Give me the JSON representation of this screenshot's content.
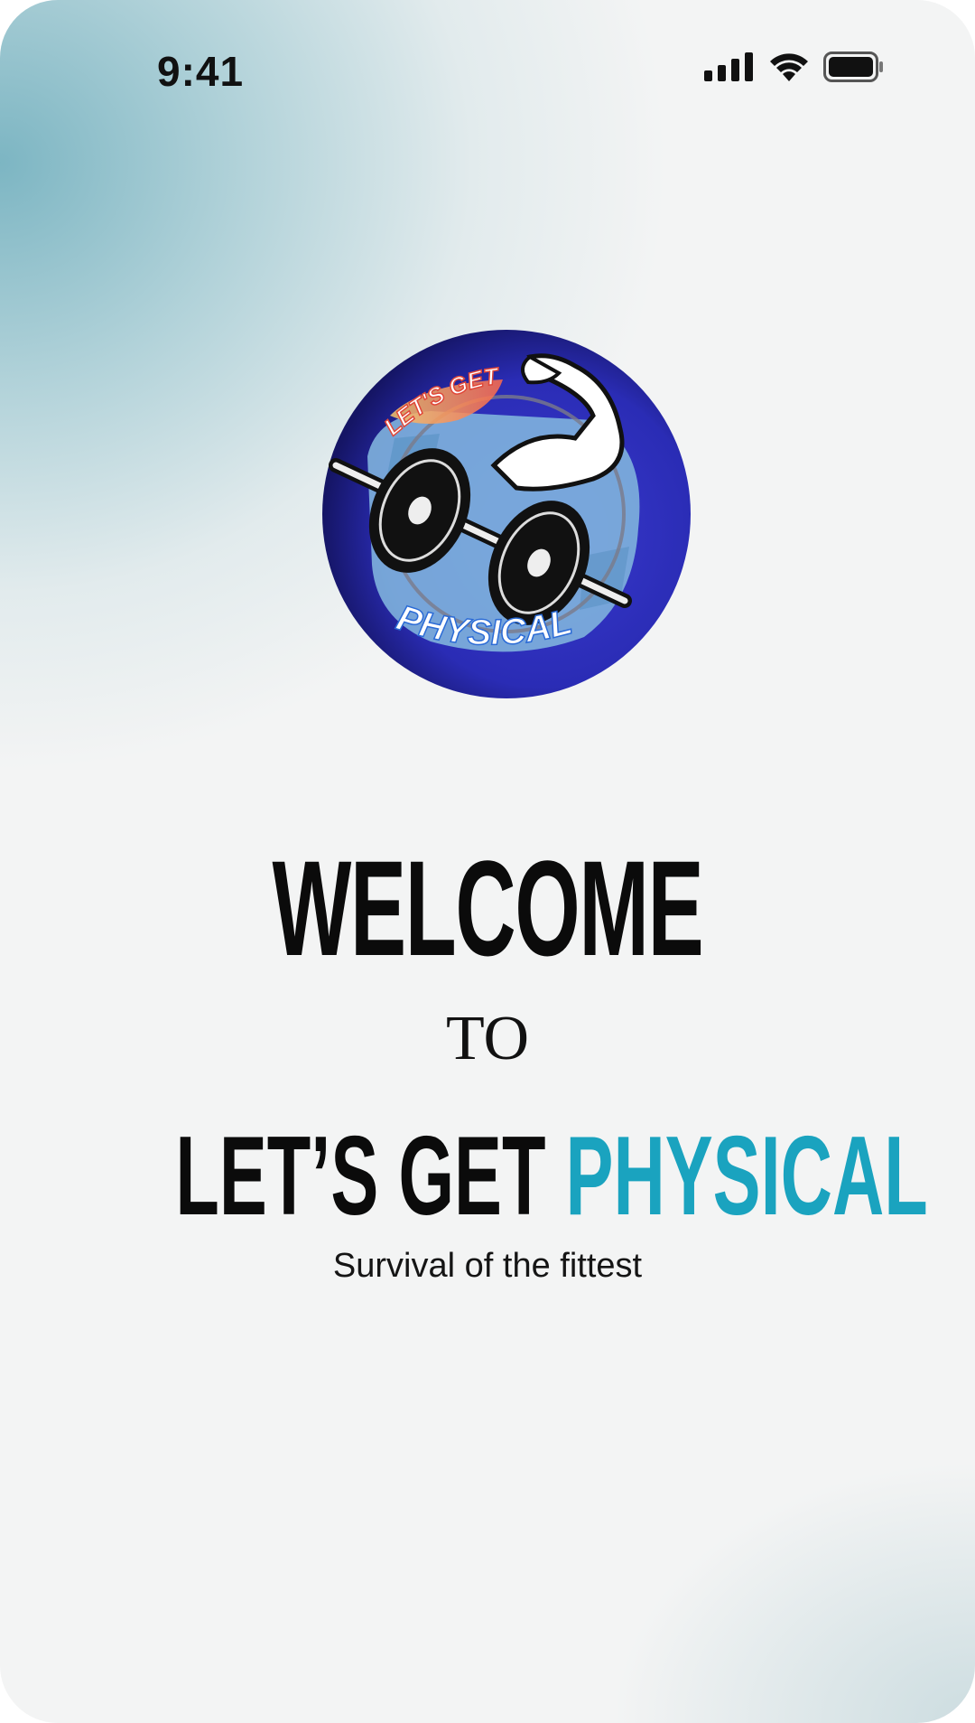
{
  "status_bar": {
    "time": "9:41",
    "icons": [
      "cellular-signal-icon",
      "wifi-icon",
      "battery-icon"
    ]
  },
  "logo": {
    "top_text": "LET'S GET",
    "bottom_text": "PHYSICAL",
    "colors": {
      "ring": "#2a2fb8",
      "inner": "#7fb3dd",
      "dark": "#0d0d2a"
    }
  },
  "welcome": {
    "heading": "WELCOME",
    "connector": "TO",
    "brand_part1": "LET’S GET",
    "brand_part2": "PHYSICAL",
    "tagline": "Survival of the fittest"
  },
  "colors": {
    "accent": "#1aa3bf",
    "text": "#0b0b0b"
  }
}
